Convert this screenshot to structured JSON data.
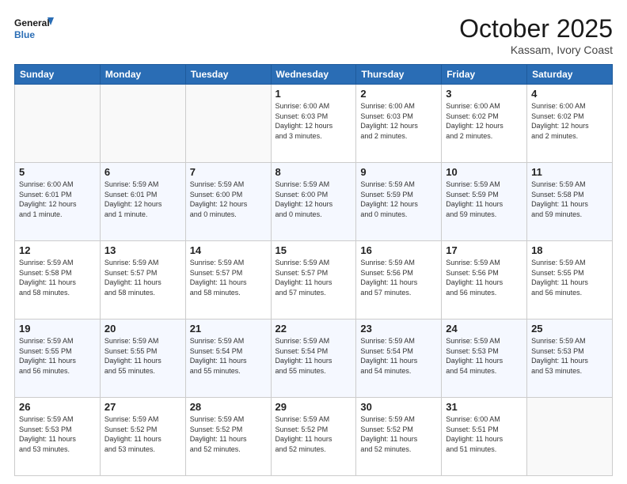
{
  "header": {
    "logo_general": "General",
    "logo_blue": "Blue",
    "month_title": "October 2025",
    "location": "Kassam, Ivory Coast"
  },
  "weekdays": [
    "Sunday",
    "Monday",
    "Tuesday",
    "Wednesday",
    "Thursday",
    "Friday",
    "Saturday"
  ],
  "weeks": [
    [
      {
        "day": "",
        "content": ""
      },
      {
        "day": "",
        "content": ""
      },
      {
        "day": "",
        "content": ""
      },
      {
        "day": "1",
        "content": "Sunrise: 6:00 AM\nSunset: 6:03 PM\nDaylight: 12 hours\nand 3 minutes."
      },
      {
        "day": "2",
        "content": "Sunrise: 6:00 AM\nSunset: 6:03 PM\nDaylight: 12 hours\nand 2 minutes."
      },
      {
        "day": "3",
        "content": "Sunrise: 6:00 AM\nSunset: 6:02 PM\nDaylight: 12 hours\nand 2 minutes."
      },
      {
        "day": "4",
        "content": "Sunrise: 6:00 AM\nSunset: 6:02 PM\nDaylight: 12 hours\nand 2 minutes."
      }
    ],
    [
      {
        "day": "5",
        "content": "Sunrise: 6:00 AM\nSunset: 6:01 PM\nDaylight: 12 hours\nand 1 minute."
      },
      {
        "day": "6",
        "content": "Sunrise: 5:59 AM\nSunset: 6:01 PM\nDaylight: 12 hours\nand 1 minute."
      },
      {
        "day": "7",
        "content": "Sunrise: 5:59 AM\nSunset: 6:00 PM\nDaylight: 12 hours\nand 0 minutes."
      },
      {
        "day": "8",
        "content": "Sunrise: 5:59 AM\nSunset: 6:00 PM\nDaylight: 12 hours\nand 0 minutes."
      },
      {
        "day": "9",
        "content": "Sunrise: 5:59 AM\nSunset: 5:59 PM\nDaylight: 12 hours\nand 0 minutes."
      },
      {
        "day": "10",
        "content": "Sunrise: 5:59 AM\nSunset: 5:59 PM\nDaylight: 11 hours\nand 59 minutes."
      },
      {
        "day": "11",
        "content": "Sunrise: 5:59 AM\nSunset: 5:58 PM\nDaylight: 11 hours\nand 59 minutes."
      }
    ],
    [
      {
        "day": "12",
        "content": "Sunrise: 5:59 AM\nSunset: 5:58 PM\nDaylight: 11 hours\nand 58 minutes."
      },
      {
        "day": "13",
        "content": "Sunrise: 5:59 AM\nSunset: 5:57 PM\nDaylight: 11 hours\nand 58 minutes."
      },
      {
        "day": "14",
        "content": "Sunrise: 5:59 AM\nSunset: 5:57 PM\nDaylight: 11 hours\nand 58 minutes."
      },
      {
        "day": "15",
        "content": "Sunrise: 5:59 AM\nSunset: 5:57 PM\nDaylight: 11 hours\nand 57 minutes."
      },
      {
        "day": "16",
        "content": "Sunrise: 5:59 AM\nSunset: 5:56 PM\nDaylight: 11 hours\nand 57 minutes."
      },
      {
        "day": "17",
        "content": "Sunrise: 5:59 AM\nSunset: 5:56 PM\nDaylight: 11 hours\nand 56 minutes."
      },
      {
        "day": "18",
        "content": "Sunrise: 5:59 AM\nSunset: 5:55 PM\nDaylight: 11 hours\nand 56 minutes."
      }
    ],
    [
      {
        "day": "19",
        "content": "Sunrise: 5:59 AM\nSunset: 5:55 PM\nDaylight: 11 hours\nand 56 minutes."
      },
      {
        "day": "20",
        "content": "Sunrise: 5:59 AM\nSunset: 5:55 PM\nDaylight: 11 hours\nand 55 minutes."
      },
      {
        "day": "21",
        "content": "Sunrise: 5:59 AM\nSunset: 5:54 PM\nDaylight: 11 hours\nand 55 minutes."
      },
      {
        "day": "22",
        "content": "Sunrise: 5:59 AM\nSunset: 5:54 PM\nDaylight: 11 hours\nand 55 minutes."
      },
      {
        "day": "23",
        "content": "Sunrise: 5:59 AM\nSunset: 5:54 PM\nDaylight: 11 hours\nand 54 minutes."
      },
      {
        "day": "24",
        "content": "Sunrise: 5:59 AM\nSunset: 5:53 PM\nDaylight: 11 hours\nand 54 minutes."
      },
      {
        "day": "25",
        "content": "Sunrise: 5:59 AM\nSunset: 5:53 PM\nDaylight: 11 hours\nand 53 minutes."
      }
    ],
    [
      {
        "day": "26",
        "content": "Sunrise: 5:59 AM\nSunset: 5:53 PM\nDaylight: 11 hours\nand 53 minutes."
      },
      {
        "day": "27",
        "content": "Sunrise: 5:59 AM\nSunset: 5:52 PM\nDaylight: 11 hours\nand 53 minutes."
      },
      {
        "day": "28",
        "content": "Sunrise: 5:59 AM\nSunset: 5:52 PM\nDaylight: 11 hours\nand 52 minutes."
      },
      {
        "day": "29",
        "content": "Sunrise: 5:59 AM\nSunset: 5:52 PM\nDaylight: 11 hours\nand 52 minutes."
      },
      {
        "day": "30",
        "content": "Sunrise: 5:59 AM\nSunset: 5:52 PM\nDaylight: 11 hours\nand 52 minutes."
      },
      {
        "day": "31",
        "content": "Sunrise: 6:00 AM\nSunset: 5:51 PM\nDaylight: 11 hours\nand 51 minutes."
      },
      {
        "day": "",
        "content": ""
      }
    ]
  ]
}
